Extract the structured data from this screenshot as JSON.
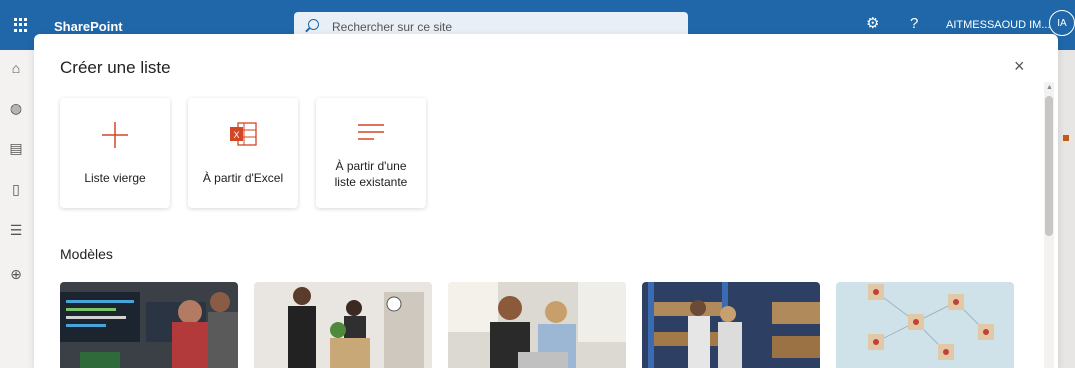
{
  "suite": {
    "brand": "SharePoint",
    "search_placeholder": "Rechercher sur ce site",
    "user": "AITMESSAOUD IM...",
    "avatar_initials": "IA",
    "bar_color": "#1f67a8"
  },
  "rail_icons": [
    "home-icon",
    "globe-icon",
    "news-icon",
    "file-icon",
    "list-icon",
    "add-icon"
  ],
  "modal": {
    "title": "Créer une liste",
    "close_glyph": "×",
    "options": [
      {
        "icon": "plus-icon",
        "label": "Liste vierge"
      },
      {
        "icon": "excel-icon",
        "label": "À partir d'Excel"
      },
      {
        "icon": "existing-list-icon",
        "label": "À partir d'une liste existante"
      }
    ],
    "templates_title": "Modèles",
    "templates": [
      "template-tech-photo",
      "template-office-photo",
      "template-meeting-photo",
      "template-warehouse-photo",
      "template-network-photo"
    ],
    "accent_color": "#d24726"
  }
}
